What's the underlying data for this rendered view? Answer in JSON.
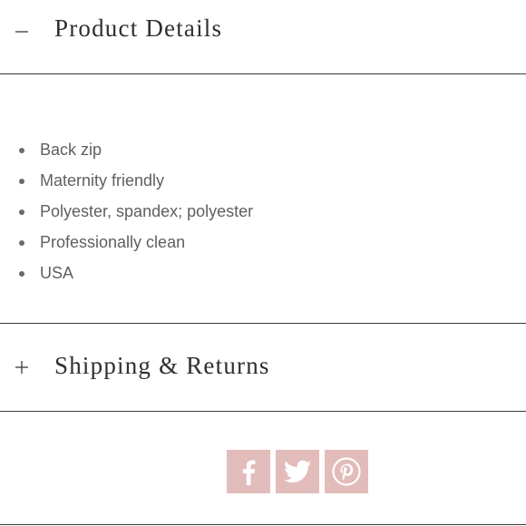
{
  "product_details": {
    "title": "Product Details",
    "expanded": true,
    "toggle_icon": "minus-icon",
    "items": [
      "Back zip",
      "Maternity friendly",
      "Polyester, spandex; polyester",
      "Professionally clean",
      "USA"
    ]
  },
  "shipping_returns": {
    "title": "Shipping & Returns",
    "expanded": false,
    "toggle_icon": "plus-icon"
  },
  "share": {
    "buttons": [
      {
        "icon": "facebook-icon"
      },
      {
        "icon": "twitter-icon"
      },
      {
        "icon": "pinterest-icon"
      }
    ],
    "button_color": "#e2bcbb",
    "icon_color": "#ffffff"
  }
}
